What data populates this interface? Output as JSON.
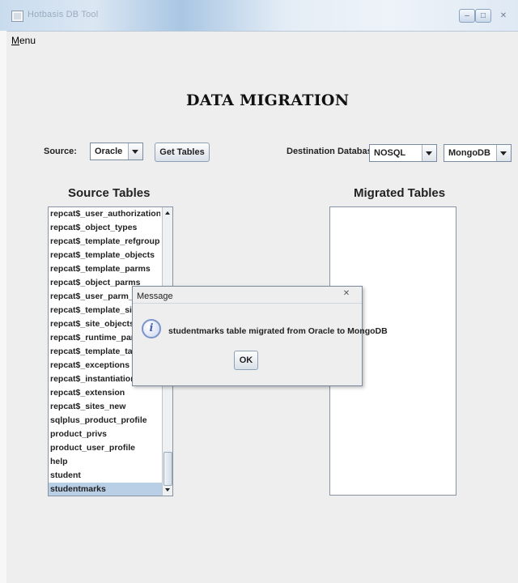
{
  "window": {
    "title": "Hotbasis DB Tool"
  },
  "menu": {
    "label": "Menu"
  },
  "header": {
    "title": "DATA MIGRATION"
  },
  "source": {
    "label": "Source:",
    "selected": "Oracle",
    "get_tables_label": "Get Tables"
  },
  "destination": {
    "label": "Destination Database:",
    "db_type": "NOSQL",
    "db_name": "MongoDB"
  },
  "source_tables": {
    "heading": "Source Tables",
    "items": [
      "repcat$_user_authorizations",
      "repcat$_object_types",
      "repcat$_template_refgroups",
      "repcat$_template_objects",
      "repcat$_template_parms",
      "repcat$_object_parms",
      "repcat$_user_parm_values",
      "repcat$_template_sites",
      "repcat$_site_objects",
      "repcat$_runtime_parms",
      "repcat$_template_targets",
      "repcat$_exceptions",
      "repcat$_instantiation_ddl",
      "repcat$_extension",
      "repcat$_sites_new",
      "sqlplus_product_profile",
      "product_privs",
      "product_user_profile",
      "help",
      "student",
      "studentmarks"
    ],
    "selected": "studentmarks"
  },
  "migrated_tables": {
    "heading": "Migrated Tables"
  },
  "dialog": {
    "title": "Message",
    "icon_glyph": "i",
    "message": "studentmarks table migrated from Oracle to MongoDB",
    "ok_label": "OK"
  }
}
